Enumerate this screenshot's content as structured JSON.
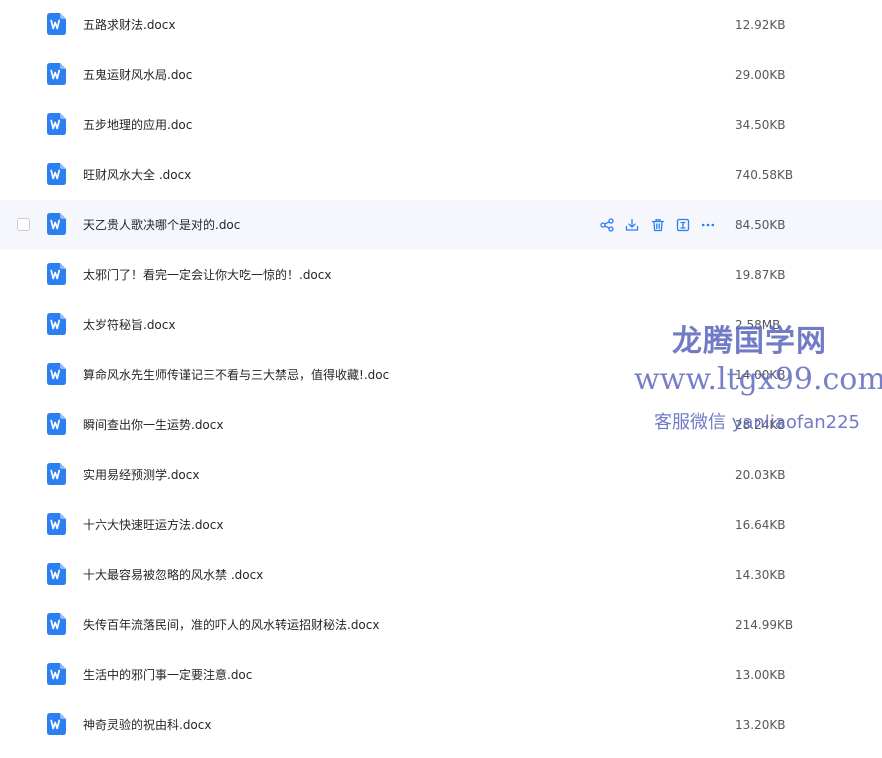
{
  "colors": {
    "accent": "#2b7ff0",
    "hover_row": "#f5f7fc",
    "text": "#25262b",
    "size_text": "#54575e",
    "watermark": "#5f69be"
  },
  "file_icon": "word-document-icon",
  "hovered_row": 4,
  "row_actions": [
    {
      "name": "share-icon"
    },
    {
      "name": "download-icon"
    },
    {
      "name": "delete-icon"
    },
    {
      "name": "details-icon"
    },
    {
      "name": "more-icon"
    }
  ],
  "files": [
    {
      "name": "五路求财法.docx",
      "size": "12.92KB"
    },
    {
      "name": "五鬼运财风水局.doc",
      "size": "29.00KB"
    },
    {
      "name": "五步地理的应用.doc",
      "size": "34.50KB"
    },
    {
      "name": "旺财风水大全 .docx",
      "size": "740.58KB"
    },
    {
      "name": "天乙贵人歌决哪个是对的.doc",
      "size": "84.50KB"
    },
    {
      "name": "太邪门了！看完一定会让你大吃一惊的！.docx",
      "size": "19.87KB"
    },
    {
      "name": "太岁符秘旨.docx",
      "size": "2.58MB"
    },
    {
      "name": "算命风水先生师传谨记三不看与三大禁忌，值得收藏!.doc",
      "size": "14.00KB"
    },
    {
      "name": "瞬间查出你一生运势.docx",
      "size": "28.24KB"
    },
    {
      "name": "实用易经预测学.docx",
      "size": "20.03KB"
    },
    {
      "name": "十六大快速旺运方法.docx",
      "size": "16.64KB"
    },
    {
      "name": "十大最容易被忽略的风水禁 .docx",
      "size": "14.30KB"
    },
    {
      "name": "失传百年流落民间，准的吓人的风水转运招财秘法.docx",
      "size": "214.99KB"
    },
    {
      "name": "生活中的邪门事一定要注意.doc",
      "size": "13.00KB"
    },
    {
      "name": "神奇灵验的祝由科.docx",
      "size": "13.20KB"
    }
  ],
  "watermark": {
    "line1": "龙腾国学网",
    "line2": "www.ltgx99.com",
    "line3": "客服微信 yanliaofan225"
  }
}
